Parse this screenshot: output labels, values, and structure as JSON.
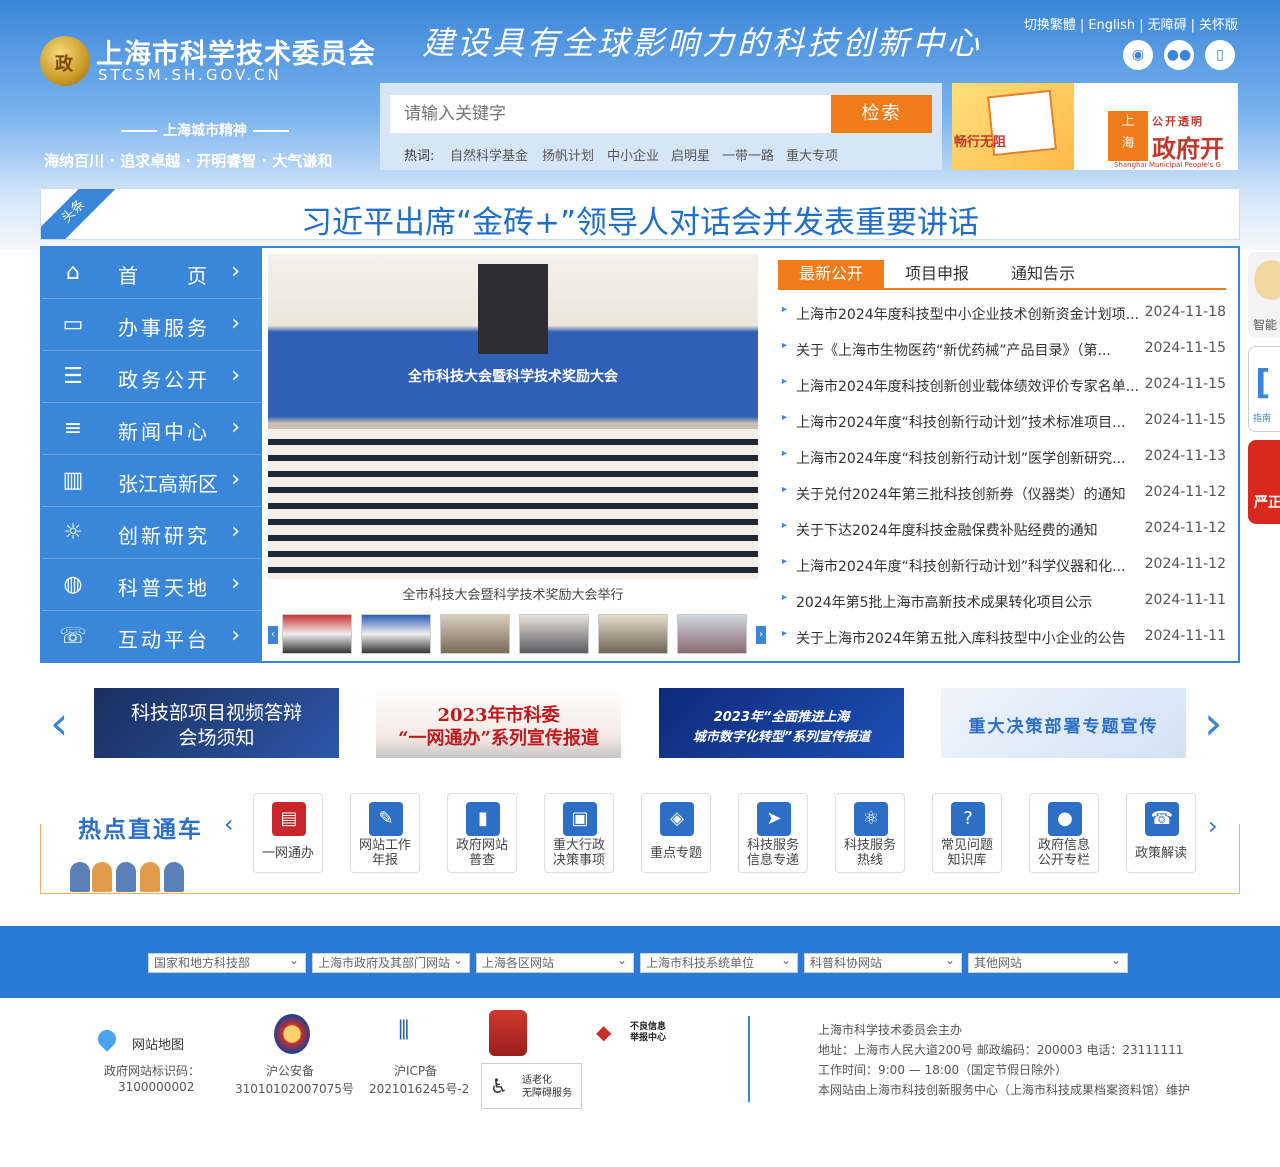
{
  "header": {
    "site_name": "上海市科学技术委员会",
    "site_domain": "STCSM.SH.GOV.CN",
    "slogan": "建设具有全球影响力的科技创新中心",
    "spirit_title": "上海城市精神",
    "spirit_text": "海纳百川 · 追求卓越 · 开明睿智 · 大气谦和",
    "toplinks": [
      "切换繁體",
      "English",
      "无障碍",
      "关怀版"
    ],
    "social_icons": [
      "weibo-icon",
      "wechat-icon",
      "mobile-icon"
    ]
  },
  "search": {
    "placeholder": "请输入关键字",
    "button": "检索",
    "hot_label": "热词:",
    "hot_words": [
      "自然科学基金",
      "扬帆计划",
      "中小企业",
      "启明星",
      "一带一路",
      "重大专项"
    ]
  },
  "side_banners": {
    "a_text": "畅行无阻",
    "b_char1": "上",
    "b_char2": "海",
    "b_t1": "公开透明",
    "b_t2": "政府开",
    "b_t3": "Shanghai Municipal People's G"
  },
  "headline": {
    "tag": "头条",
    "text": "习近平出席“金砖+”领导人对话会并发表重要讲话"
  },
  "nav": [
    {
      "label": "首　　页",
      "icon": "home-icon"
    },
    {
      "label": "办事服务",
      "icon": "service-icon"
    },
    {
      "label": "政务公开",
      "icon": "document-icon"
    },
    {
      "label": "新闻中心",
      "icon": "news-icon"
    },
    {
      "label": "张江高新区",
      "icon": "building-icon"
    },
    {
      "label": "创新研究",
      "icon": "bulb-icon"
    },
    {
      "label": "科普天地",
      "icon": "globe-icon"
    },
    {
      "label": "互动平台",
      "icon": "chat-icon"
    }
  ],
  "photo": {
    "screen_text": "全市科技大会暨科学技术奖励大会",
    "caption": "全市科技大会暨科学技术奖励大会举行"
  },
  "tabs": [
    "最新公开",
    "项目申报",
    "通知告示"
  ],
  "news": [
    {
      "title": "上海市2024年度科技型中小企业技术创新资金计划项...",
      "date": "2024-11-18"
    },
    {
      "title": "关于《上海市生物医药“新优药械”产品目录》（第...",
      "date": "2024-11-15"
    },
    {
      "title": "上海市2024年度科技创新创业载体绩效评价专家名单...",
      "date": "2024-11-15"
    },
    {
      "title": "上海市2024年度“科技创新行动计划”技术标准项目...",
      "date": "2024-11-15"
    },
    {
      "title": "上海市2024年度“科技创新行动计划”医学创新研究...",
      "date": "2024-11-13"
    },
    {
      "title": "关于兑付2024年第三批科技创新券（仪器类）的通知",
      "date": "2024-11-12"
    },
    {
      "title": "关于下达2024年度科技金融保费补贴经费的通知",
      "date": "2024-11-12"
    },
    {
      "title": "上海市2024年度“科技创新行动计划”科学仪器和化...",
      "date": "2024-11-12"
    },
    {
      "title": "2024年第5批上海市高新技术成果转化项目公示",
      "date": "2024-11-11"
    },
    {
      "title": "关于上海市2024年第五批入库科技型中小企业的公告",
      "date": "2024-11-11"
    }
  ],
  "floats": {
    "f1": "智能",
    "f2": "指南",
    "f3": "严正"
  },
  "carousel": {
    "b1_l1": "科技部项目视频答辩",
    "b1_l2": "会场须知",
    "b2_l1": "2023年市科委",
    "b2_l2": "“一网通办”系列宣传报道",
    "b3_l1": "2023年“全面推进上海",
    "b3_l2": "城市数字化转型”系列宣传报道",
    "b4_l1": "重大决策部署专题宣传"
  },
  "hot": {
    "title": "热点直通车",
    "items": [
      {
        "label": "一网通办",
        "icon": "form-icon"
      },
      {
        "label": "网站工作\n年报",
        "icon": "edit-icon"
      },
      {
        "label": "政府网站\n普查",
        "icon": "book-icon"
      },
      {
        "label": "重大行政\n决策事项",
        "icon": "decision-icon"
      },
      {
        "label": "重点专题",
        "icon": "layers-icon"
      },
      {
        "label": "科技服务\n信息专递",
        "icon": "send-icon"
      },
      {
        "label": "科技服务\n热线",
        "icon": "atom-icon"
      },
      {
        "label": "常见问题\n知识库",
        "icon": "faq-icon"
      },
      {
        "label": "政府信息\n公开专栏",
        "icon": "person-icon"
      },
      {
        "label": "政策解读",
        "icon": "phone-icon"
      }
    ]
  },
  "footer": {
    "selects": [
      "国家和地方科技部",
      "上海市政府及其部门网站",
      "上海各区网站",
      "上海市科技系统单位",
      "科普科协网站",
      "其他网站"
    ],
    "sitemap": "网站地图",
    "site_id_label": "政府网站标识码：",
    "site_id": "3100000002",
    "police_label": "沪公安备",
    "police_no": "31010102007075号",
    "icp_label": "沪ICP备",
    "icp_no": "2021016245号-2",
    "bad_info": "不良信息\n举报中心",
    "elderly": "适老化\n无障碍服务",
    "host": "上海市科学技术委员会主办",
    "address": "地址：上海市人民大道200号 邮政编码：200003 电话：23111111",
    "hours": "工作时间：9:00 — 18:00（国定节假日除外）",
    "maintainer": "本网站由上海市科技创新服务中心（上海市科技成果档案资料馆）维护"
  }
}
